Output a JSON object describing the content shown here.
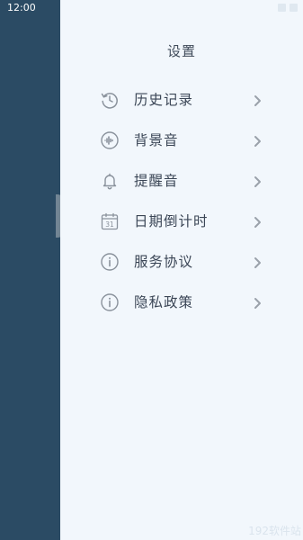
{
  "status_bar": {
    "time": "12:00"
  },
  "panel": {
    "title": "设置"
  },
  "menu": {
    "items": [
      {
        "label": "历史记录",
        "icon": "history-icon"
      },
      {
        "label": "背景音",
        "icon": "sound-wave-icon"
      },
      {
        "label": "提醒音",
        "icon": "bell-icon"
      },
      {
        "label": "日期倒计时",
        "icon": "calendar-icon",
        "calendar_day": "31"
      },
      {
        "label": "服务协议",
        "icon": "info-icon"
      },
      {
        "label": "隐私政策",
        "icon": "info-icon"
      }
    ]
  },
  "watermark": {
    "text": "192软件站"
  },
  "colors": {
    "sidebar_bg": "#2b4b64",
    "panel_bg": "#f2f7fc",
    "text": "#3b4656",
    "icon": "#8a929c",
    "chevron": "#9aa1aa"
  }
}
